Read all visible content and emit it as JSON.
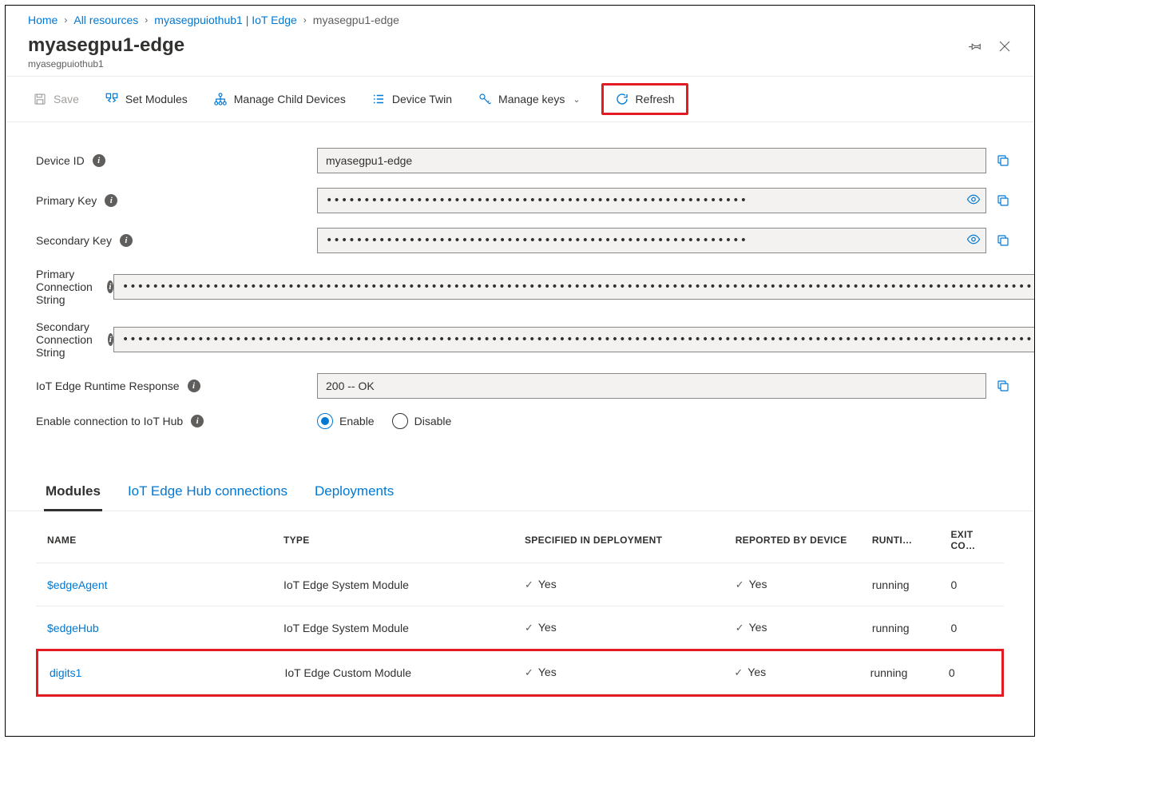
{
  "breadcrumb": [
    {
      "label": "Home",
      "link": true
    },
    {
      "label": "All resources",
      "link": true
    },
    {
      "label": "myasegpuiothub1 | IoT Edge",
      "link": true
    },
    {
      "label": "myasegpu1-edge",
      "link": false
    }
  ],
  "title": "myasegpu1-edge",
  "subtitle": "myasegpuiothub1",
  "toolbar": {
    "save": "Save",
    "set_modules": "Set Modules",
    "manage_child": "Manage Child Devices",
    "device_twin": "Device Twin",
    "manage_keys": "Manage keys",
    "refresh": "Refresh"
  },
  "fields": {
    "device_id": {
      "label": "Device ID",
      "value": "myasegpu1-edge"
    },
    "primary_key": {
      "label": "Primary Key",
      "value": "••••••••••••••••••••••••••••••••••••••••••••••••••••••••"
    },
    "secondary_key": {
      "label": "Secondary Key",
      "value": "••••••••••••••••••••••••••••••••••••••••••••••••••••••••"
    },
    "primary_conn": {
      "label": "Primary Connection String",
      "value": "••••••••••••••••••••••••••••••••••••••••••••••••••••••••••••••••••••••••••••••••••••••••••••••••••••••••••••••••••••••••••••••••••••…"
    },
    "secondary_conn": {
      "label": "Secondary Connection String",
      "value": "••••••••••••••••••••••••••••••••••••••••••••••••••••••••••••••••••••••••••••••••••••••••••••••••••••••••••••••••••••••••••••••••••••…"
    },
    "runtime_resp": {
      "label": "IoT Edge Runtime Response",
      "value": "200 -- OK"
    },
    "enable_conn": {
      "label": "Enable connection to IoT Hub",
      "enable": "Enable",
      "disable": "Disable"
    }
  },
  "tabs": {
    "modules": "Modules",
    "connections": "IoT Edge Hub connections",
    "deployments": "Deployments"
  },
  "table": {
    "headers": {
      "name": "NAME",
      "type": "TYPE",
      "spec": "SPECIFIED IN DEPLOYMENT",
      "reported": "REPORTED BY DEVICE",
      "runtime": "RUNTI…",
      "exit": "EXIT CO…"
    },
    "rows": [
      {
        "name": "$edgeAgent",
        "type": "IoT Edge System Module",
        "spec": "Yes",
        "reported": "Yes",
        "runtime": "running",
        "exit": "0"
      },
      {
        "name": "$edgeHub",
        "type": "IoT Edge System Module",
        "spec": "Yes",
        "reported": "Yes",
        "runtime": "running",
        "exit": "0"
      },
      {
        "name": "digits1",
        "type": "IoT Edge Custom Module",
        "spec": "Yes",
        "reported": "Yes",
        "runtime": "running",
        "exit": "0"
      }
    ]
  }
}
